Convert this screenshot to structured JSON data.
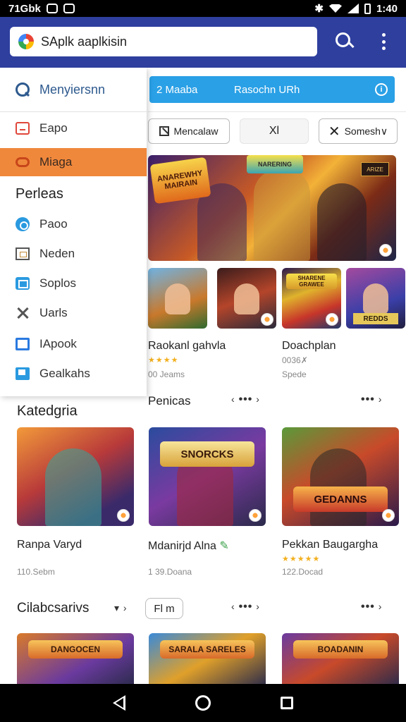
{
  "status_bar": {
    "left_text": "71Gbk",
    "time": "1:40"
  },
  "app_bar": {
    "search_text": "SAplk aaplkisin"
  },
  "banner": {
    "left": "2  Maaba",
    "right": "Rasochn URh"
  },
  "chips": {
    "first": "Mencalaw",
    "second": "Χl",
    "third": "Somesh∨"
  },
  "hero": {
    "title": "ANAREWHY MAIRAIN",
    "top_text": "NARERING",
    "badge": "ARIZE"
  },
  "games": [
    {
      "title": "Raokanl gahvla",
      "meta": "00 Jeams"
    },
    {
      "title": "Doachplan",
      "meta": "0036✗",
      "meta2": "Spede"
    }
  ],
  "thumb_labels": {
    "third": "SHARENE GRAWEE",
    "fourth": "REDDS"
  },
  "sections": {
    "categories": "Katedgria",
    "popular": "Penicas",
    "cats2": "Cilabcsarivs",
    "filter": "Fl m"
  },
  "cards": [
    {
      "title": "Ranpa Varyd",
      "meta": "110.Sebm"
    },
    {
      "title": "Mdanirjd Alna",
      "meta": "1 39.Doana",
      "logo": "SNORCKS"
    },
    {
      "title": "Pekkan Baugargha",
      "meta": "122.Docad",
      "logo": "GEDANNS"
    }
  ],
  "bottom_cards": [
    "DANGOCEN",
    "SARALA SARELES",
    "BOADANIN"
  ],
  "drawer": {
    "header": "Menyiersnn",
    "items": [
      "Eapo",
      "Miaga"
    ],
    "section": "Perleas",
    "sub_items": [
      "Paoo",
      "Neden",
      "Soplos",
      "Uarls",
      "IApook",
      "Gealkahs"
    ]
  }
}
